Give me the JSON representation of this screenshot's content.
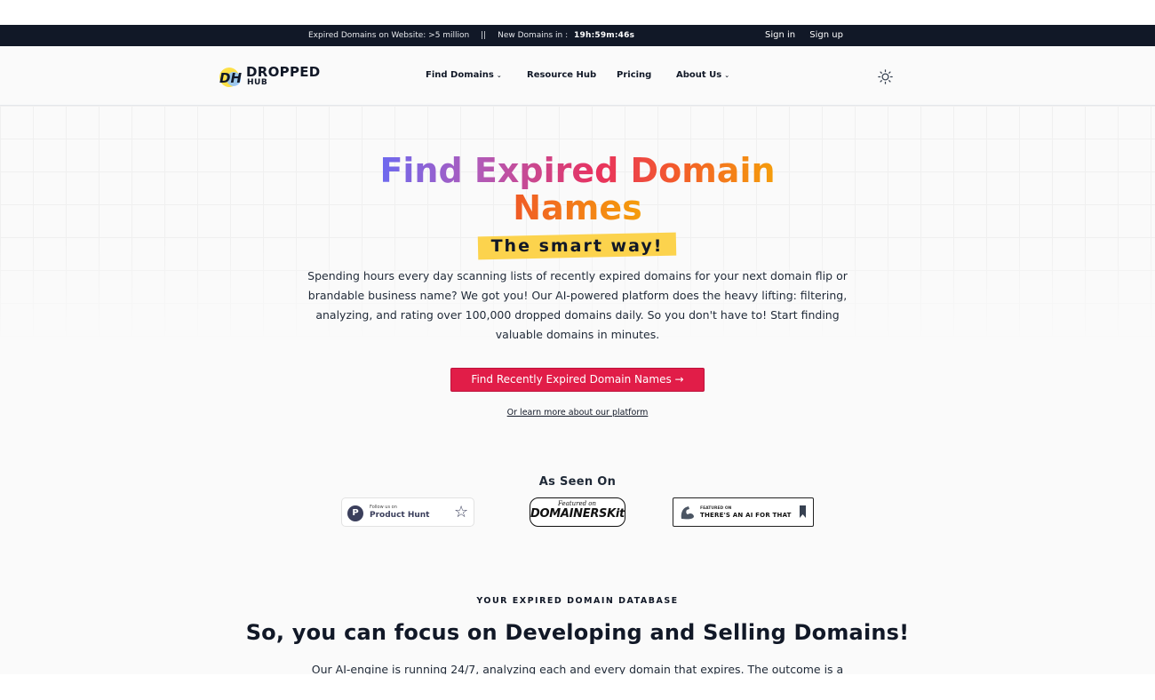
{
  "announcement": {
    "expired_label": "Expired Domains on Website: >5 million",
    "separator": "||",
    "new_label": "New Domains in :",
    "countdown": "19h:59m:46s",
    "sign_in": "Sign in",
    "sign_up": "Sign up"
  },
  "logo": {
    "mark_text": "DH",
    "word1": "DROPPED",
    "word2": "HUB"
  },
  "nav": {
    "items": [
      {
        "label": "Find Domains",
        "has_dropdown": true
      },
      {
        "label": "Resource Hub",
        "has_dropdown": false
      },
      {
        "label": "Pricing",
        "has_dropdown": false
      },
      {
        "label": "About Us",
        "has_dropdown": true
      }
    ],
    "caret_glyph": "⌄",
    "theme_icon": "sun-icon"
  },
  "hero": {
    "title_line1": "Find Expired Domain",
    "title_line2": "Names",
    "tagline": "The smart way!",
    "description": "Spending hours every day scanning lists of recently expired domains for your next domain flip or brandable business name? We got you! Our AI-powered platform does the heavy lifting: filtering, analyzing, and rating over 100,000 dropped domains daily. So you don't have to! Start finding valuable domains in minutes.",
    "cta_label": "Find Recently Expired Domain Names →",
    "learn_more": "Or learn more about our platform"
  },
  "as_seen_on": {
    "title": "As Seen On",
    "product_hunt": {
      "small": "Follow us on",
      "name": "Product Hunt",
      "logo_letter": "P",
      "star": "☆"
    },
    "domainers_kit": {
      "small": "Featured on",
      "name": "DOMAINERSKit"
    },
    "ai_for_that": {
      "small": "FEATURED ON",
      "name": "THERE'S AN AI FOR THAT"
    }
  },
  "database": {
    "eyebrow": "YOUR EXPIRED DOMAIN DATABASE",
    "heading": "So, you can focus on Developing and Selling Domains!",
    "body": "Our AI-engine is running 24/7, analyzing each and every domain that expires. The outcome is a"
  },
  "colors": {
    "topbar": "#111827",
    "cta": "#e11d48",
    "highlight": "#fcd34d"
  }
}
